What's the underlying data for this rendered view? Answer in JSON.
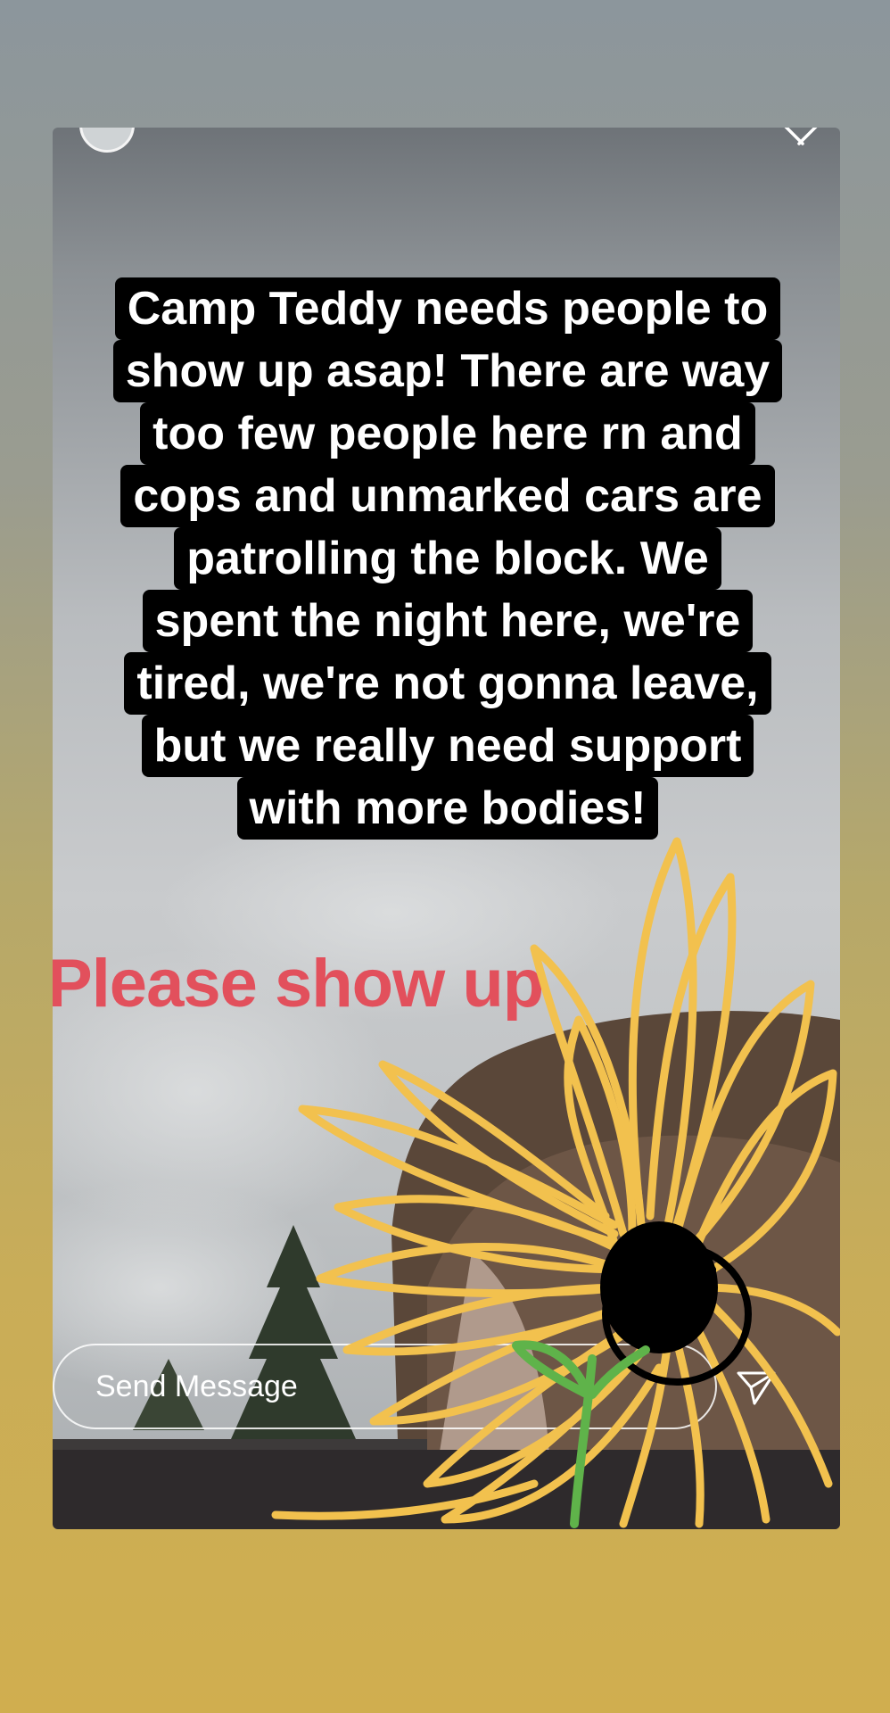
{
  "story": {
    "caption_lines": [
      "Camp Teddy needs people to",
      "show up asap! There are way",
      "too few people here rn and",
      "cops and unmarked cars are",
      "patrolling the block. We",
      "spent the night here, we're",
      "tired, we're not gonna leave,",
      "but we really need support",
      "with more bodies!"
    ],
    "highlight_text": "Please show up",
    "highlight_color": "#e2505c",
    "doodle_color": "#f2c14e"
  },
  "reply_bar": {
    "placeholder": "Send Message"
  },
  "icons": {
    "close": "close-icon",
    "send": "paper-plane-icon",
    "avatar": "avatar"
  }
}
